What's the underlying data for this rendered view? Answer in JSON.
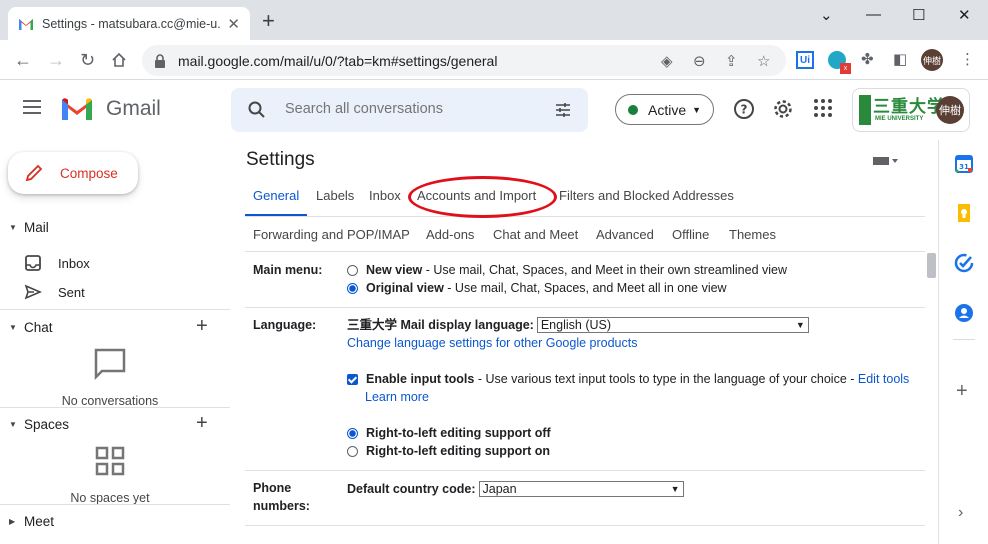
{
  "browser": {
    "tab_title": "Settings - matsubara.cc@mie-u.a",
    "url": "mail.google.com/mail/u/0/?tab=km#settings/general",
    "profile_initial": "伸樹"
  },
  "header": {
    "app_name": "Gmail",
    "search_placeholder": "Search all conversations",
    "status_label": "Active",
    "university_name": "三重大学",
    "university_sub": "MIE UNIVERSITY",
    "avatar_text": "伸樹"
  },
  "sidebar": {
    "compose_label": "Compose",
    "mail_section": "Mail",
    "items": [
      {
        "label": "Inbox",
        "icon": "inbox-icon"
      },
      {
        "label": "Sent",
        "icon": "send-icon"
      }
    ],
    "chat_section": "Chat",
    "chat_empty": "No conversations",
    "spaces_section": "Spaces",
    "spaces_empty": "No spaces yet",
    "meet_section": "Meet"
  },
  "settings": {
    "title": "Settings",
    "tabs_row1": [
      "General",
      "Labels",
      "Inbox",
      "Accounts and Import",
      "Filters and Blocked Addresses"
    ],
    "tabs_row2": [
      "Forwarding and POP/IMAP",
      "Add-ons",
      "Chat and Meet",
      "Advanced",
      "Offline",
      "Themes"
    ],
    "active_tab": "General",
    "main_menu": {
      "label": "Main menu:",
      "new_view_title": "New view",
      "new_view_desc": " - Use mail, Chat, Spaces, and Meet in their own streamlined view",
      "original_view_title": "Original view",
      "original_view_desc": " - Use mail, Chat, Spaces, and Meet all in one view"
    },
    "language": {
      "label": "Language:",
      "display_label": "三重大学 Mail display language:",
      "display_value": "English (US)",
      "change_link": "Change language settings for other Google products",
      "input_tools_title": "Enable input tools",
      "input_tools_desc": " - Use various text input tools to type in the language of your choice - ",
      "edit_tools_link": "Edit tools",
      "learn_more": "Learn more",
      "rtl_off": "Right-to-left editing support off",
      "rtl_on": "Right-to-left editing support on"
    },
    "phone": {
      "label_line1": "Phone",
      "label_line2": "numbers:",
      "country_label": "Default country code:",
      "country_value": "Japan"
    }
  },
  "colors": {
    "accent": "#0b57d0",
    "compose_text": "#d93025",
    "annotation_circle": "#e0101a",
    "status_green": "#188038"
  }
}
